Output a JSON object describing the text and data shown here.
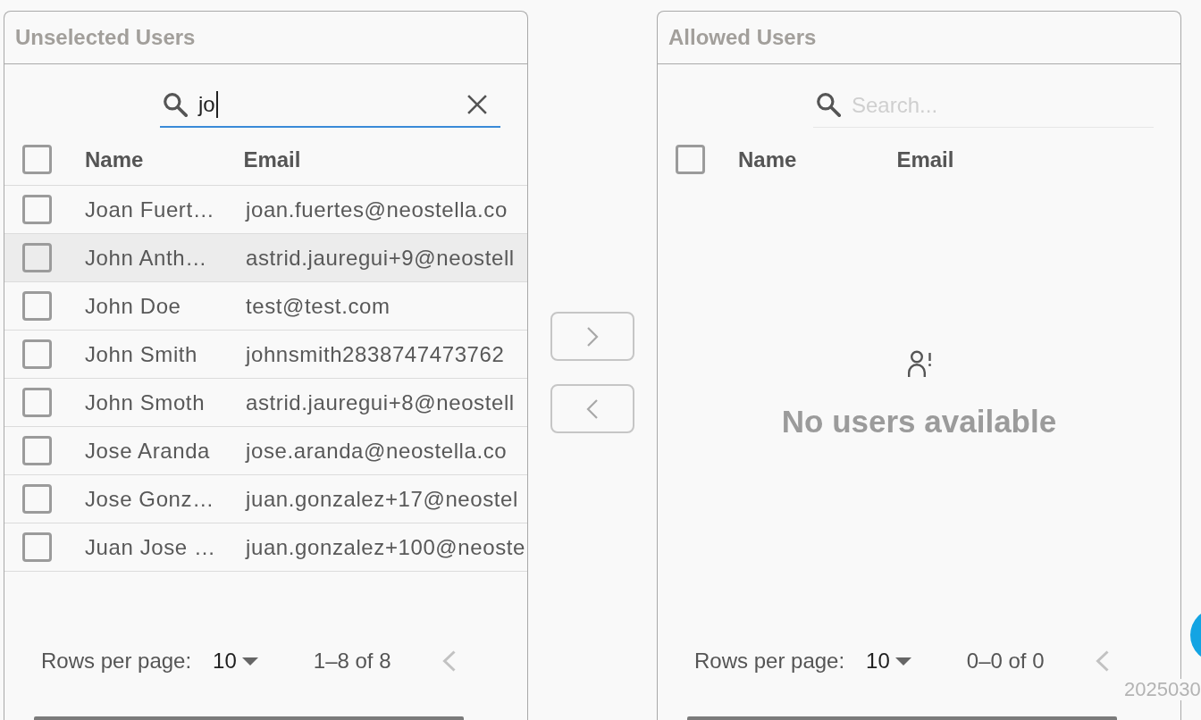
{
  "panels": [
    {
      "title": "Unselected Users",
      "search": {
        "value": "jo",
        "focused": true
      },
      "select_all_checked": false,
      "columns": [
        "Name",
        "Email"
      ],
      "rows": [
        {
          "name": "Joan Fuert…",
          "email": "joan.fuertes@neostella.co",
          "checked": false,
          "hovered": false
        },
        {
          "name": "John Anth…",
          "email": "astrid.jauregui+9@neostell",
          "checked": false,
          "hovered": true
        },
        {
          "name": "John Doe",
          "email": "test@test.com",
          "checked": false,
          "hovered": false
        },
        {
          "name": "John Smith",
          "email": "johnsmith2838747473762",
          "checked": false,
          "hovered": false
        },
        {
          "name": "John Smoth",
          "email": "astrid.jauregui+8@neostell",
          "checked": false,
          "hovered": false
        },
        {
          "name": "Jose Aranda",
          "email": "jose.aranda@neostella.co",
          "checked": false,
          "hovered": false
        },
        {
          "name": "Jose Gonz…",
          "email": "juan.gonzalez+17@neostel",
          "checked": false,
          "hovered": false
        },
        {
          "name": "Juan Jose …",
          "email": "juan.gonzalez+100@neoste",
          "checked": false,
          "hovered": false
        }
      ],
      "pagination": {
        "rows_per_page_label": "Rows per page:",
        "rows_per_page": "10",
        "range": "1–8 of 8",
        "previous_disabled": true
      }
    },
    {
      "title": "Allowed Users",
      "search": {
        "placeholder": "Search...",
        "focused": false
      },
      "select_all_checked": false,
      "columns": [
        "Name",
        "Email"
      ],
      "empty_message": "No users available",
      "pagination": {
        "rows_per_page_label": "Rows per page:",
        "rows_per_page": "10",
        "range": "0–0 of 0",
        "previous_disabled": true
      }
    }
  ],
  "transfer_buttons": [
    {
      "kind": "right",
      "disabled": true
    },
    {
      "kind": "left",
      "disabled": true
    }
  ],
  "build_label": "2025030"
}
